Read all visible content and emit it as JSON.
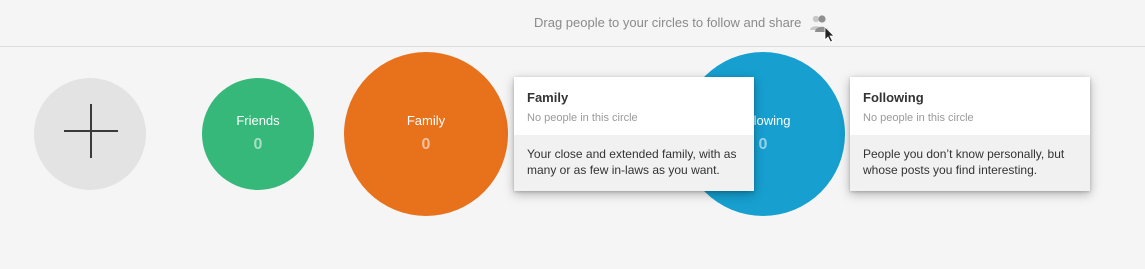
{
  "header": {
    "hint": "Drag people to your circles to follow and share",
    "icon": "people-drag-icon"
  },
  "circles": [
    {
      "name": "",
      "icon": "plus-icon",
      "color": "#e3e3e3"
    },
    {
      "name": "Friends",
      "count": "0",
      "color": "#35b879"
    },
    {
      "name": "Family",
      "count": "0",
      "color": "#e8711c"
    },
    {
      "name": "Following",
      "count": "0",
      "color": "#169fcf"
    }
  ],
  "cards": {
    "family": {
      "title": "Family",
      "subtitle": "No people in this circle",
      "description": "Your close and extended family, with as many or as few in-laws as you want."
    },
    "following": {
      "title": "Following",
      "subtitle": "No people in this circle",
      "description": "People you don’t know personally, but whose posts you find interesting."
    }
  },
  "colors": {
    "background": "#f5f5f5",
    "friends": "#35b879",
    "family": "#e8711c",
    "following": "#169fcf"
  }
}
